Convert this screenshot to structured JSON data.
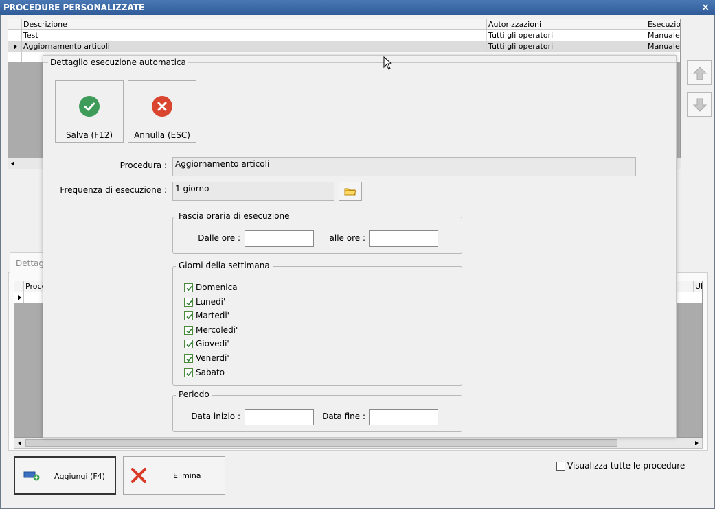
{
  "window": {
    "title": "PROCEDURE PERSONALIZZATE",
    "close_glyph": "×"
  },
  "top_grid": {
    "columns": [
      "Descrizione",
      "Autorizzazioni",
      "Esecuzion"
    ],
    "rows": [
      {
        "descrizione": "Test",
        "autorizzazioni": "Tutti gli operatori",
        "esecuzione": "Manuale",
        "selected": false
      },
      {
        "descrizione": "Aggiornamento articoli",
        "autorizzazioni": "Tutti gli operatori",
        "esecuzione": "Manuale",
        "selected": true
      }
    ]
  },
  "side_buttons": {
    "up_icon": "arrow-up-icon",
    "down_icon": "arrow-down-icon"
  },
  "detail_tab": {
    "label": "Dettagl"
  },
  "bottom_grid": {
    "columns": [
      "Proce",
      "Ul"
    ]
  },
  "bottom_buttons": {
    "add_label": "Aggiungi (F4)",
    "delete_label": "Elimina",
    "show_all_label": "Visualizza tutte le procedure",
    "show_all_checked": false
  },
  "modal": {
    "title": "Dettaglio esecuzione automatica",
    "save_label": "Salva (F12)",
    "cancel_label": "Annulla (ESC)",
    "procedura_label": "Procedura :",
    "procedura_value": "Aggiornamento articoli",
    "frequenza_label": "Frequenza di esecuzione :",
    "frequenza_value": "1 giorno",
    "fascia": {
      "legend": "Fascia oraria di esecuzione",
      "dalle_label": "Dalle ore :",
      "dalle_value": "",
      "alle_label": "alle ore :",
      "alle_value": ""
    },
    "giorni": {
      "legend": "Giorni della settimana",
      "days": [
        {
          "label": "Domenica",
          "checked": true
        },
        {
          "label": "Lunedi'",
          "checked": true
        },
        {
          "label": "Martedi'",
          "checked": true
        },
        {
          "label": "Mercoledi'",
          "checked": true
        },
        {
          "label": "Giovedi'",
          "checked": true
        },
        {
          "label": "Venerdi'",
          "checked": true
        },
        {
          "label": "Sabato",
          "checked": true
        }
      ]
    },
    "periodo": {
      "legend": "Periodo",
      "inizio_label": "Data inizio :",
      "inizio_value": "",
      "fine_label": "Data fine :",
      "fine_value": ""
    }
  },
  "colors": {
    "titlebar": "#3b6aa8",
    "save_green": "#3f9b59",
    "cancel_red": "#d9452f",
    "grid_gray": "#ababab"
  }
}
